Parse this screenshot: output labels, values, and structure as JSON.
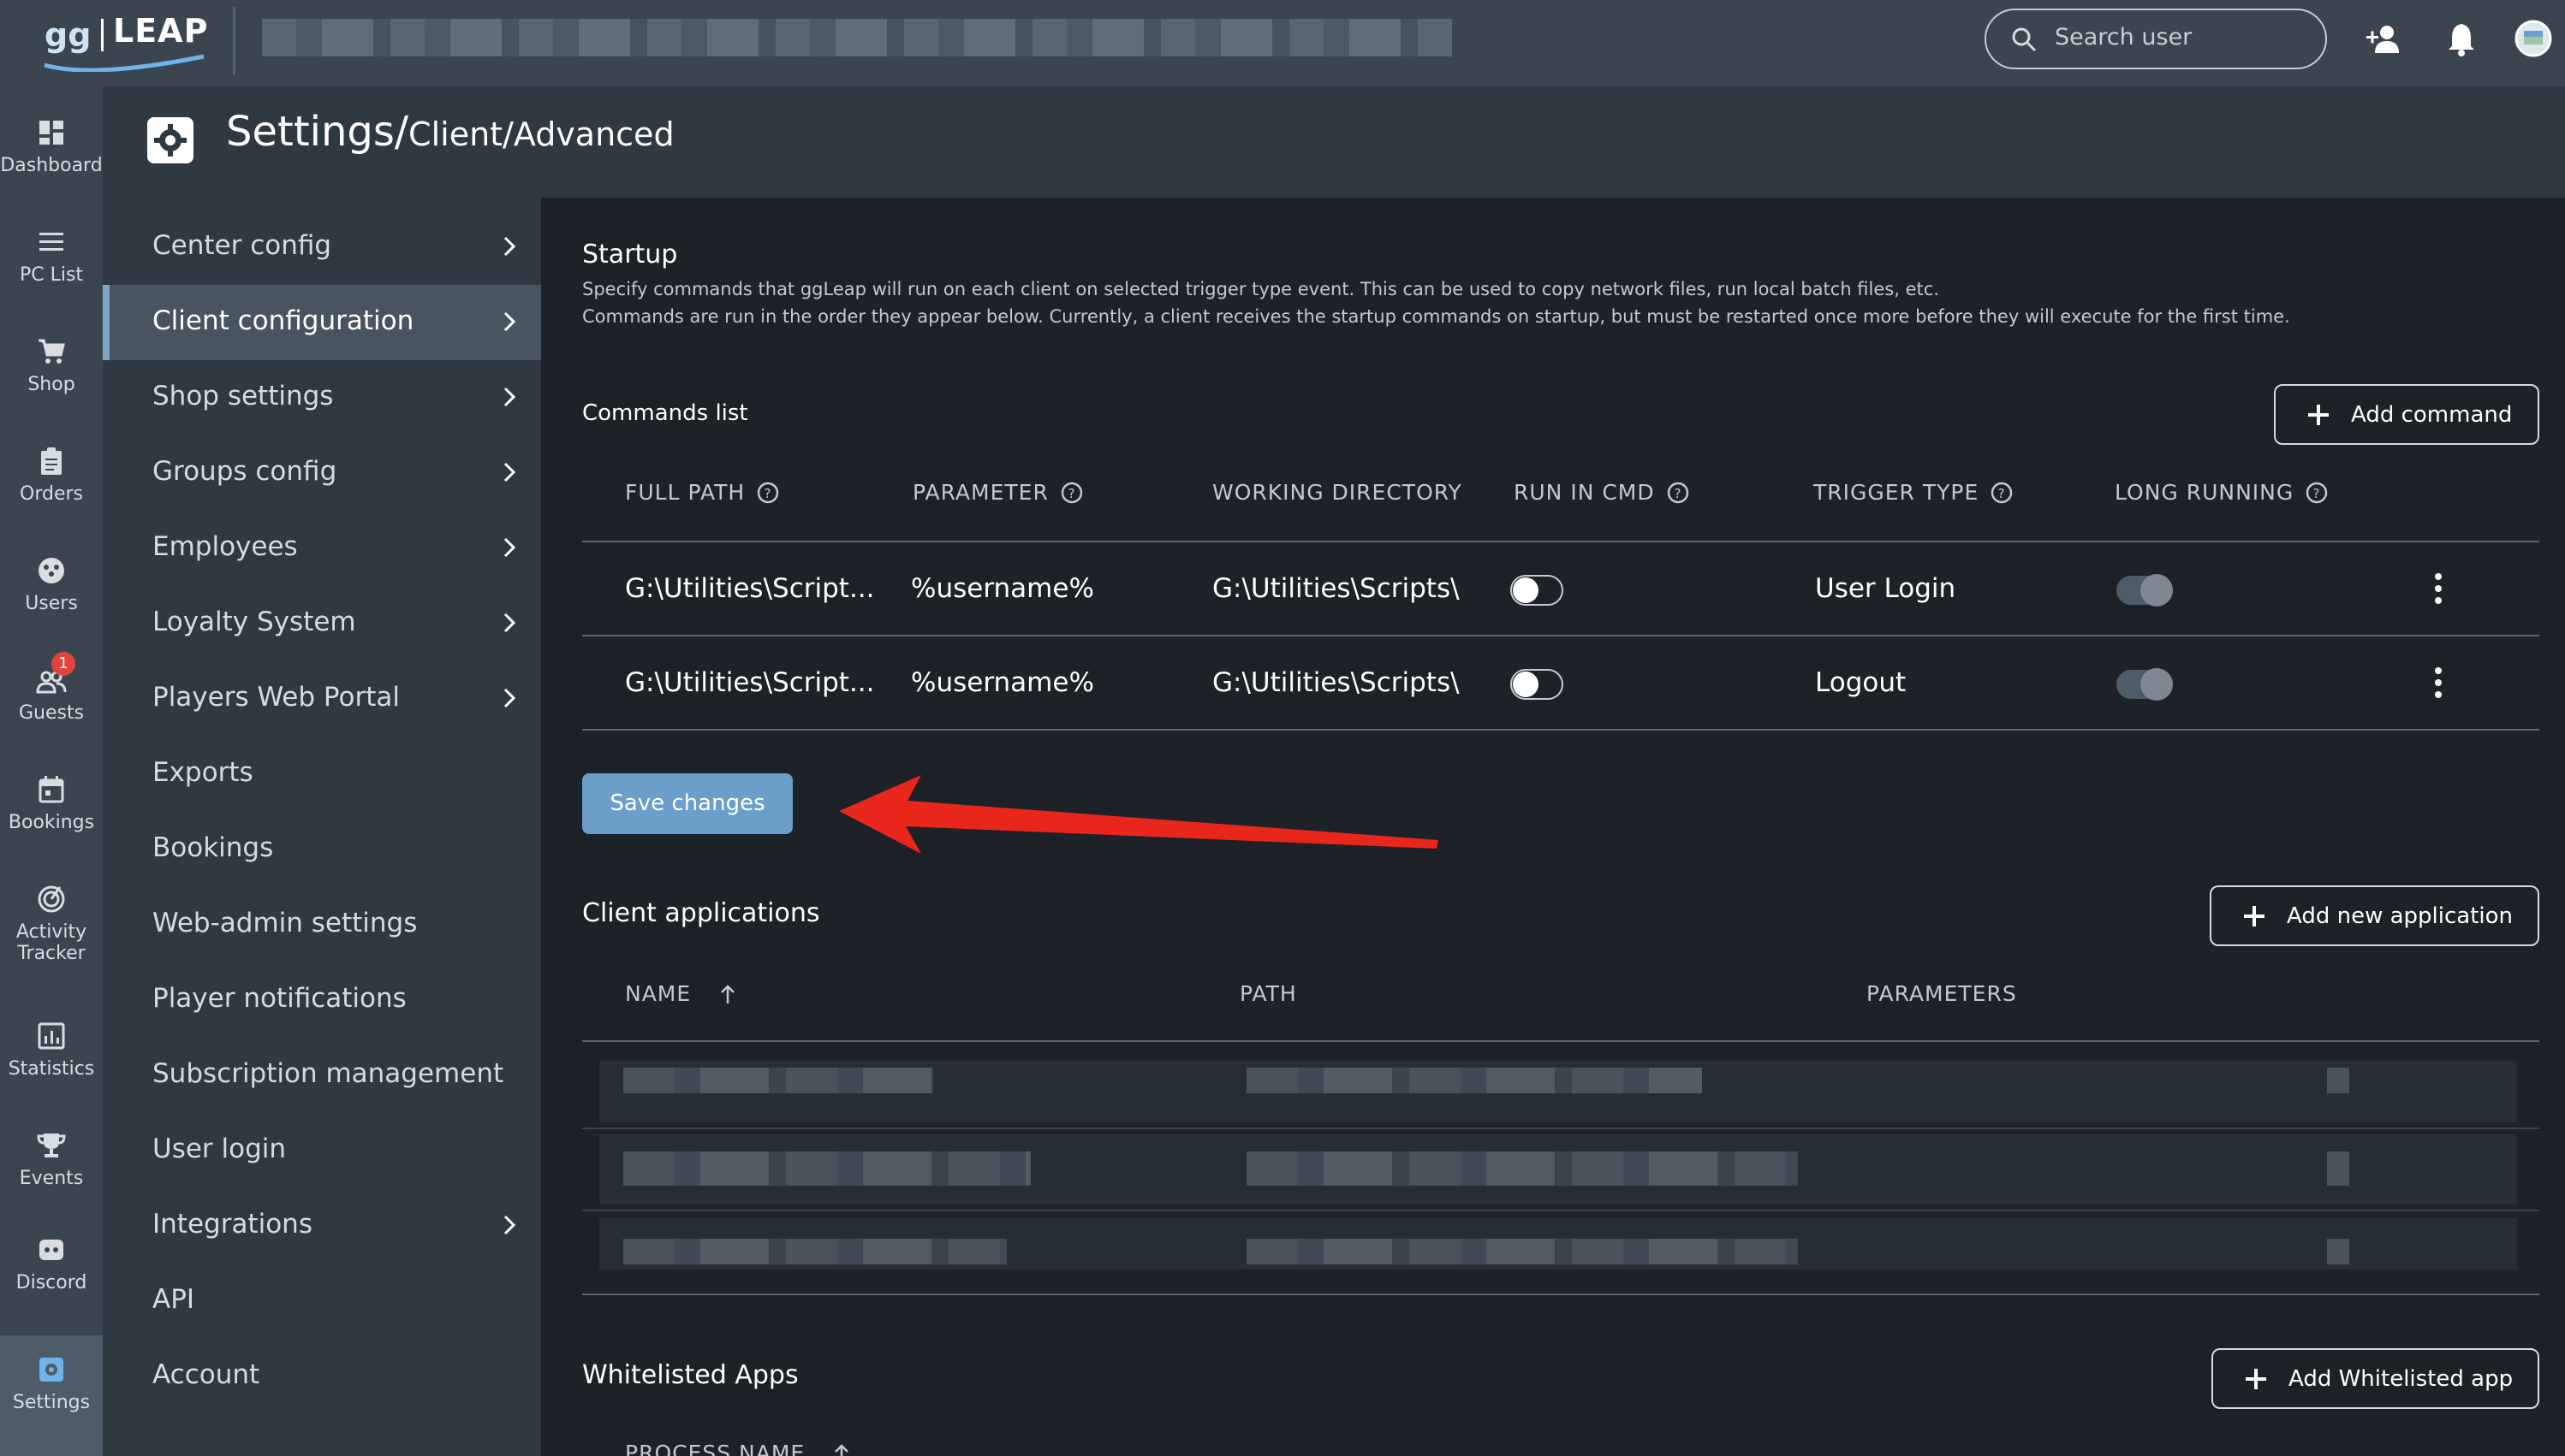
{
  "brand": {
    "name": "LEAP"
  },
  "topbar": {
    "search_placeholder": "Search user",
    "icons": [
      "add-user-icon",
      "bell-icon",
      "avatar"
    ]
  },
  "rail": {
    "items": [
      {
        "label": "Dashboard",
        "icon": "dashboard-icon"
      },
      {
        "label": "PC List",
        "icon": "list-icon"
      },
      {
        "label": "Shop",
        "icon": "cart-icon"
      },
      {
        "label": "Orders",
        "icon": "clipboard-icon"
      },
      {
        "label": "Users",
        "icon": "users-icon"
      },
      {
        "label": "Guests",
        "icon": "guests-icon",
        "badge": "1"
      },
      {
        "label": "Bookings",
        "icon": "calendar-icon"
      },
      {
        "label": "Activity",
        "label2": "Tracker",
        "icon": "radar-icon"
      },
      {
        "label": "Statistics",
        "icon": "chart-icon"
      },
      {
        "label": "Events",
        "icon": "trophy-icon"
      },
      {
        "label": "Discord",
        "icon": "discord-icon"
      },
      {
        "label": "Settings",
        "icon": "gear-icon",
        "active": true
      }
    ]
  },
  "header": {
    "title": "Settings/",
    "subtitle": "Client/Advanced"
  },
  "menu": {
    "items": [
      {
        "label": "Center config",
        "chevron": true
      },
      {
        "label": "Client configuration",
        "chevron": true,
        "active": true
      },
      {
        "label": "Shop settings",
        "chevron": true
      },
      {
        "label": "Groups config",
        "chevron": true
      },
      {
        "label": "Employees",
        "chevron": true
      },
      {
        "label": "Loyalty System",
        "chevron": true
      },
      {
        "label": "Players Web Portal",
        "chevron": true
      },
      {
        "label": "Exports",
        "chevron": false
      },
      {
        "label": "Bookings",
        "chevron": false
      },
      {
        "label": "Web-admin settings",
        "chevron": false
      },
      {
        "label": "Player notifications",
        "chevron": false
      },
      {
        "label": "Subscription management",
        "chevron": false
      },
      {
        "label": "User login",
        "chevron": false
      },
      {
        "label": "Integrations",
        "chevron": true
      },
      {
        "label": "API",
        "chevron": false
      },
      {
        "label": "Account",
        "chevron": false
      }
    ]
  },
  "startup": {
    "title": "Startup",
    "desc1": "Specify commands that ggLeap will run on each client on selected trigger type event. This can be used to copy network files, run local batch files, etc.",
    "desc2": "Commands are run in the order they appear below. Currently, a client receives the startup commands on startup, but must be restarted once more before they will execute for the first time."
  },
  "commands": {
    "title": "Commands list",
    "add_label": "Add command",
    "columns": [
      "FULL PATH",
      "PARAMETER",
      "WORKING DIRECTORY",
      "RUN IN CMD",
      "TRIGGER TYPE",
      "LONG RUNNING"
    ],
    "rows": [
      {
        "full_path": "G:\\Utilities\\Script...",
        "parameter": "%username%",
        "working_dir": "G:\\Utilities\\Scripts\\",
        "run_in_cmd": false,
        "trigger": "User Login",
        "long_running": true
      },
      {
        "full_path": "G:\\Utilities\\Script...",
        "parameter": "%username%",
        "working_dir": "G:\\Utilities\\Scripts\\",
        "run_in_cmd": false,
        "trigger": "Logout",
        "long_running": true
      }
    ],
    "save_label": "Save changes"
  },
  "apps": {
    "title": "Client applications",
    "add_label": "Add new application",
    "columns": [
      "NAME",
      "PATH",
      "PARAMETERS"
    ]
  },
  "whitelist": {
    "title": "Whitelisted Apps",
    "add_label": "Add Whitelisted app",
    "columns": [
      "PROCESS NAME"
    ]
  },
  "colors": {
    "accent": "#6b9ec9",
    "annotation_arrow": "#e8261c",
    "badge": "#e0443d"
  }
}
